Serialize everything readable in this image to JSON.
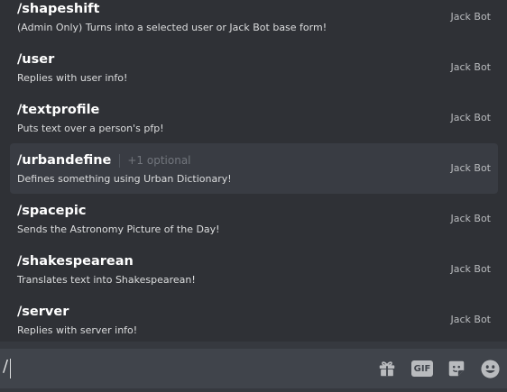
{
  "autocomplete": {
    "commands": [
      {
        "name": "/shapeshift",
        "optional": "",
        "description": "(Admin Only) Turns into a selected user or Jack Bot base form!",
        "source": "Jack Bot",
        "selected": false
      },
      {
        "name": "/user",
        "optional": "",
        "description": "Replies with user info!",
        "source": "Jack Bot",
        "selected": false
      },
      {
        "name": "/textprofile",
        "optional": "",
        "description": "Puts text over a person's pfp!",
        "source": "Jack Bot",
        "selected": false
      },
      {
        "name": "/urbandefine",
        "optional": "+1 optional",
        "description": "Defines something using Urban Dictionary!",
        "source": "Jack Bot",
        "selected": true
      },
      {
        "name": "/spacepic",
        "optional": "",
        "description": "Sends the Astronomy Picture of the Day!",
        "source": "Jack Bot",
        "selected": false
      },
      {
        "name": "/shakespearean",
        "optional": "",
        "description": "Translates text into Shakespearean!",
        "source": "Jack Bot",
        "selected": false
      },
      {
        "name": "/server",
        "optional": "",
        "description": "Replies with server info!",
        "source": "Jack Bot",
        "selected": false
      }
    ]
  },
  "message_input": {
    "value": "/"
  },
  "toolbar": {
    "gift_icon": "gift-icon",
    "gif_label": "GIF",
    "sticker_icon": "sticker-icon",
    "emoji_icon": "emoji-icon"
  },
  "colors": {
    "background": "#2f3136",
    "selected_row": "#393c43",
    "input_background": "#40444b",
    "icon": "#b9bbbe"
  }
}
